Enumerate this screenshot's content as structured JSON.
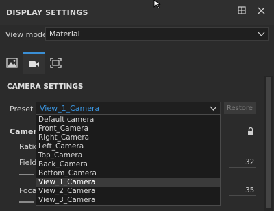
{
  "panel": {
    "title": "DISPLAY SETTINGS"
  },
  "view_mode": {
    "label": "View mode",
    "value": "Material"
  },
  "tabs": [
    {
      "name": "image"
    },
    {
      "name": "camera",
      "active": true
    },
    {
      "name": "frame"
    }
  ],
  "camera_settings": {
    "title": "CAMERA SETTINGS",
    "preset_label": "Preset",
    "preset_value": "View_1_Camera",
    "restore_label": "Restore",
    "camera_label": "Camer",
    "ratio_label": "Ratio",
    "field_label": "Field",
    "field_value": "32",
    "focal_label": "Foca",
    "focal_value": "35"
  },
  "dropdown": {
    "options": [
      "Default camera",
      "Front_Camera",
      "Right_Camera",
      "Left_Camera",
      "Top_Camera",
      "Back_Camera",
      "Bottom_Camera",
      "View_1_Camera",
      "View_2_Camera",
      "View_3_Camera"
    ],
    "selected": "View_1_Camera"
  },
  "icons": {
    "dock": "dock-icon",
    "close": "close-icon",
    "lock": "lock-icon",
    "chevron": "chevron-down-icon"
  }
}
